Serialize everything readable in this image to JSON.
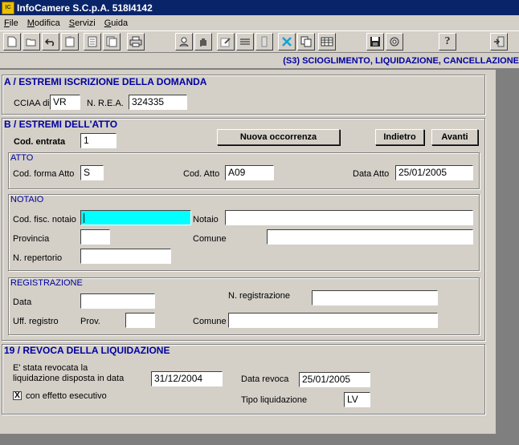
{
  "window": {
    "title": "InfoCamere S.C.p.A. 518I4142",
    "app_icon_text": "IC"
  },
  "menu": [
    {
      "label": "File",
      "accel": "F",
      "rest": "ile"
    },
    {
      "label": "Modifica",
      "accel": "M",
      "rest": "odifica"
    },
    {
      "label": "Servizi",
      "accel": "S",
      "rest": "ervizi"
    },
    {
      "label": "Guida",
      "accel": "G",
      "rest": "uida"
    }
  ],
  "toolbar": {
    "icons": [
      "new-doc-icon",
      "open-folder-icon",
      "undo-icon",
      "clipboard-icon",
      "page-icon",
      "copy-page-icon",
      "print-icon",
      "person-search-icon",
      "hand-icon",
      "edit-icon",
      "stack-icon",
      "tag-icon",
      "delete-x-icon",
      "copy-icon",
      "grid-icon",
      "save-icon",
      "settings-icon",
      "help-icon",
      "exit-icon"
    ]
  },
  "form_title": "(S3) SCIOGLIMENTO, LIQUIDAZIONE, CANCELLAZIONE",
  "section_a": {
    "title": "A / ESTREMI ISCRIZIONE DELLA DOMANDA",
    "cciaa_label": "CCIAA di",
    "cciaa_value": "VR",
    "rea_label": "N. R.E.A.",
    "rea_value": "324335"
  },
  "section_b": {
    "title": "B / ESTREMI DELL'ATTO",
    "cod_entrata_label": "Cod. entrata",
    "cod_entrata_value": "1",
    "nuova_occorrenza": "Nuova occorrenza",
    "indietro": "Indietro",
    "avanti": "Avanti",
    "atto": {
      "title": "ATTO",
      "cod_forma_label": "Cod. forma Atto",
      "cod_forma_value": "S",
      "cod_atto_label": "Cod. Atto",
      "cod_atto_value": "A09",
      "data_atto_label": "Data Atto",
      "data_atto_value": "25/01/2005"
    },
    "notaio": {
      "title": "NOTAIO",
      "cod_fisc_label": "Cod. fisc. notaio",
      "cod_fisc_value": "",
      "notaio_label": "Notaio",
      "notaio_value": "",
      "provincia_label": "Provincia",
      "provincia_value": "",
      "comune_label": "Comune",
      "comune_value": "",
      "repertorio_label": "N. repertorio",
      "repertorio_value": ""
    },
    "registrazione": {
      "title": "REGISTRAZIONE",
      "data_label": "Data",
      "data_value": "",
      "n_reg_label": "N. registrazione",
      "n_reg_value": "",
      "uff_label": "Uff. registro",
      "prov_label": "Prov.",
      "prov_value": "",
      "comune_label": "Comune",
      "comune_value": ""
    }
  },
  "section_19": {
    "title": "19 / REVOCA DELLA LIQUIDAZIONE",
    "revocata_line1": "E' stata revocata la",
    "revocata_line2": "liquidazione disposta in data",
    "revocata_value": "31/12/2004",
    "data_revoca_label": "Data revoca",
    "data_revoca_value": "25/01/2005",
    "effetto_label": "con effetto esecutivo",
    "effetto_checked": "X",
    "tipo_label": "Tipo liquidazione",
    "tipo_value": "LV"
  }
}
